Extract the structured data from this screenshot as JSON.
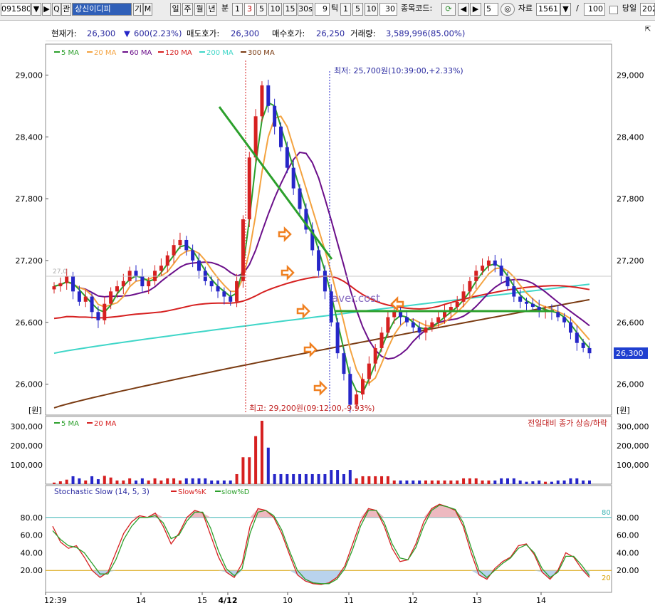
{
  "toolbar": {
    "code": "091580",
    "name": "상신이디피",
    "fav_label": "관",
    "gm_label": "기",
    "m_label": "M",
    "periods": [
      "일",
      "주",
      "월",
      "년",
      "분"
    ],
    "minute_options": [
      "1",
      "3",
      "5",
      "10",
      "15",
      "30s"
    ],
    "selected_minute": "3",
    "tick_value": "9",
    "tick_label": "틱",
    "tick_options": [
      "1",
      "5",
      "10"
    ],
    "count_value": "30",
    "stock_code_label": "종목코드:",
    "step_value": "5",
    "data_label": "자료",
    "data_value": "1561",
    "slash": "/",
    "page_value": "100",
    "today_label": "당일",
    "date_value": "202"
  },
  "info": {
    "price_label": "현재가:",
    "price": "26,300",
    "change_symbol": "▼",
    "change": "600(2.23%)",
    "ask_label": "매도호가:",
    "ask": "26,300",
    "bid_label": "매수호가:",
    "bid": "26,250",
    "volume_label": "거래량:",
    "volume": "3,589,996(85.00%)"
  },
  "colors": {
    "ma5": "#2ca02c",
    "ma20": "#f4a340",
    "ma60": "#6b0f8a",
    "ma120": "#d62020",
    "ma200": "#3fd6c8",
    "ma300": "#7a3b12",
    "up": "#d62020",
    "down": "#2626c8",
    "trend": "#2ca02c",
    "arrow": "#f08020",
    "slowK": "#d62020",
    "slowD": "#2ca02c",
    "line80": "#3fb6b6",
    "line20": "#d9a000",
    "price_tag": "#1f3fd0"
  },
  "chart_data": [
    {
      "type": "candlestick",
      "title": "",
      "ylabel": "[원]",
      "ylim": [
        25700,
        29300
      ],
      "yticks": [
        "29,000",
        "28,400",
        "27,800",
        "27,200",
        "26,600",
        "26,000"
      ],
      "ytick_values": [
        29000,
        28400,
        27800,
        27200,
        26600,
        26000
      ],
      "legend": [
        "5 MA",
        "20 MA",
        "60 MA",
        "120 MA",
        "200 MA",
        "300 MA"
      ],
      "ma_values_first_last": {
        "5 MA": [
          26950,
          26300
        ],
        "20 MA": [
          27000,
          26550
        ],
        "60 MA": [
          26720,
          26750
        ],
        "120 MA": [
          26650,
          27000
        ],
        "200 MA": [
          26300,
          26970
        ],
        "300 MA": [
          25770,
          26820
        ]
      },
      "current_price": "26,300",
      "annotations": {
        "low": "최저: 25,700원(10:39:00,+2.33%)",
        "high": "최고: 29,200원(09:12:00,-9.93%)",
        "avg": "aver.cost",
        "ref_value": "27,0"
      },
      "close_series": [
        26950,
        26980,
        27050,
        26900,
        26800,
        26850,
        26700,
        26620,
        26780,
        26900,
        26950,
        27000,
        27100,
        27050,
        26950,
        27000,
        27100,
        27150,
        27250,
        27350,
        27400,
        27300,
        27200,
        27100,
        27000,
        26950,
        26900,
        26850,
        26800,
        27000,
        27600,
        28200,
        28600,
        28900,
        28700,
        28500,
        28300,
        28100,
        27900,
        27700,
        27500,
        27300,
        27100,
        26900,
        26600,
        26300,
        26100,
        25800,
        25900,
        26050,
        26200,
        26350,
        26500,
        26650,
        26700,
        26650,
        26600,
        26550,
        26500,
        26550,
        26600,
        26650,
        26700,
        26750,
        26800,
        26900,
        27000,
        27100,
        27150,
        27200,
        27150,
        27050,
        26950,
        26850,
        26800,
        26780,
        26750,
        26700,
        26720,
        26700,
        26650,
        26600,
        26500,
        26400,
        26350,
        26300
      ]
    },
    {
      "type": "bar",
      "title": "",
      "legend": [
        "5 MA",
        "20 MA"
      ],
      "right_label": "전일대비 종가 상승/하락",
      "ylim": [
        0,
        330000
      ],
      "yticks": [
        "300,000",
        "200,000",
        "100,000"
      ],
      "ytick_values": [
        300000,
        200000,
        100000
      ],
      "max_volume": 330000
    },
    {
      "type": "line",
      "title": "Stochastic Slow (14, 5, 3)",
      "legend": [
        "Slow%K",
        "slow%D"
      ],
      "ylim": [
        0,
        100
      ],
      "yticks": [
        "80.00",
        "60.00",
        "40.00",
        "20.00"
      ],
      "ytick_values": [
        80,
        60,
        40,
        20
      ],
      "levels": [
        "80",
        "20"
      ],
      "level_values": [
        80,
        20
      ],
      "k_series": [
        70,
        52,
        45,
        48,
        35,
        20,
        12,
        18,
        40,
        62,
        75,
        82,
        80,
        85,
        70,
        50,
        62,
        80,
        88,
        85,
        60,
        35,
        18,
        12,
        28,
        70,
        90,
        88,
        80,
        62,
        38,
        15,
        8,
        5,
        4,
        6,
        12,
        25,
        50,
        75,
        90,
        88,
        70,
        45,
        30,
        32,
        50,
        75,
        90,
        95,
        92,
        88,
        70,
        40,
        15,
        10,
        22,
        30,
        35,
        48,
        50,
        38,
        18,
        10,
        20,
        40,
        35,
        22,
        12
      ],
      "d_series": [
        65,
        55,
        48,
        46,
        40,
        28,
        16,
        16,
        32,
        55,
        70,
        80,
        80,
        82,
        74,
        56,
        60,
        76,
        86,
        86,
        68,
        42,
        22,
        14,
        22,
        62,
        86,
        88,
        82,
        66,
        42,
        20,
        10,
        6,
        5,
        5,
        10,
        22,
        44,
        70,
        88,
        88,
        74,
        50,
        34,
        32,
        46,
        70,
        88,
        94,
        92,
        89,
        74,
        46,
        20,
        12,
        20,
        28,
        34,
        45,
        49,
        40,
        22,
        12,
        18,
        36,
        36,
        26,
        14
      ]
    }
  ],
  "xaxis": {
    "labels": [
      "12:39",
      "14",
      "15",
      "4/12",
      "10",
      "11",
      "12",
      "13",
      "14"
    ]
  }
}
